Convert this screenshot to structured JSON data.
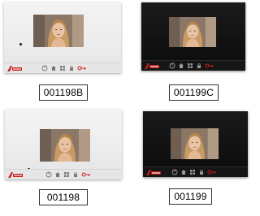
{
  "products": [
    {
      "code": "001198B",
      "finish": "white",
      "logo_text": "AVIDSEN"
    },
    {
      "code": "001199C",
      "finish": "black",
      "logo_text": "AVIDSEN"
    },
    {
      "code": "001198",
      "finish": "white",
      "logo_text": "AVIDSEN"
    },
    {
      "code": "001199",
      "finish": "black",
      "logo_text": "AVIDSEN"
    }
  ],
  "buttons": [
    "power-icon",
    "home-icon",
    "grid-icon",
    "lock-icon",
    "key-icon"
  ],
  "colors": {
    "logo_red": "#c81e1e",
    "white_panel": "#f0f0f0",
    "black_panel": "#111111",
    "label_border": "#333333"
  }
}
